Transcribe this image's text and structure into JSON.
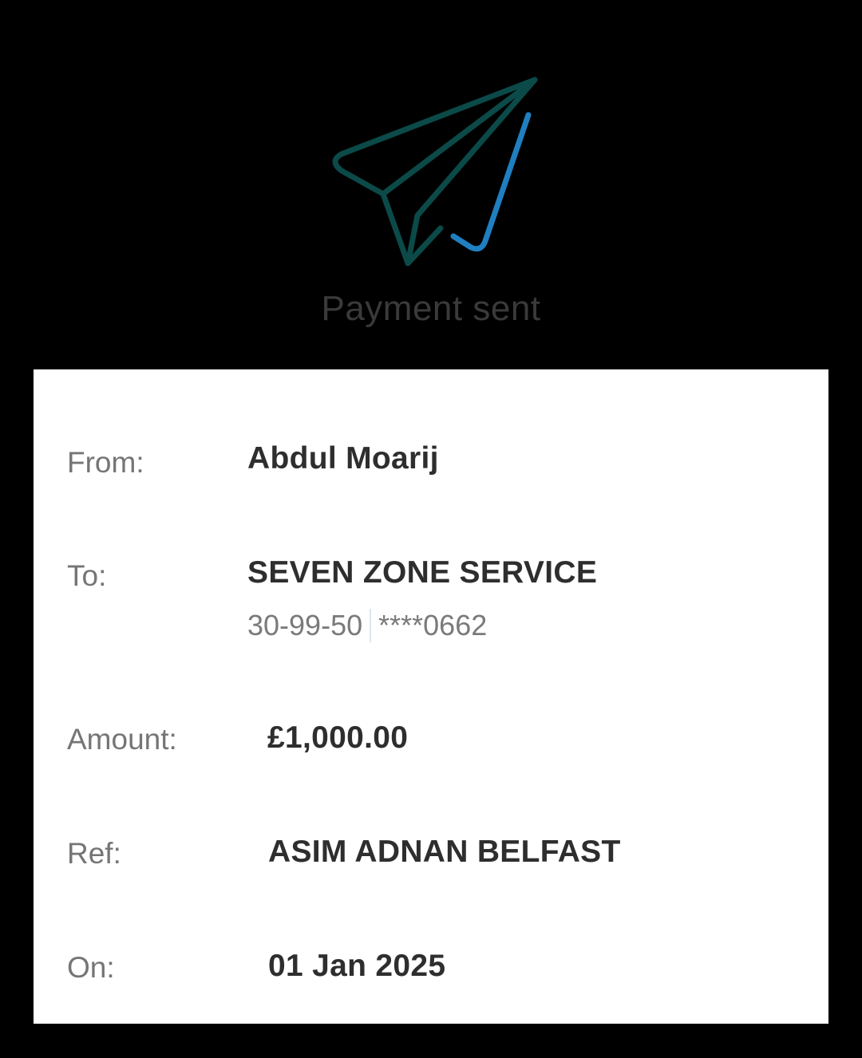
{
  "hero": {
    "icon": "paper-plane-icon",
    "title": "Payment sent",
    "colors": {
      "plane": "#0b4a48",
      "check": "#1f7fc0",
      "background": "#000000"
    }
  },
  "details": {
    "from": {
      "label": "From:",
      "value": "Abdul Moarij"
    },
    "to": {
      "label": "To:",
      "value": "SEVEN ZONE SERVICE",
      "sort_code": "30-99-50",
      "account": "****0662"
    },
    "amount": {
      "label": "Amount:",
      "value": "£1,000.00"
    },
    "ref": {
      "label": "Ref:",
      "value": "ASIM ADNAN BELFAST"
    },
    "on": {
      "label": "On:",
      "value": "01 Jan 2025"
    }
  }
}
